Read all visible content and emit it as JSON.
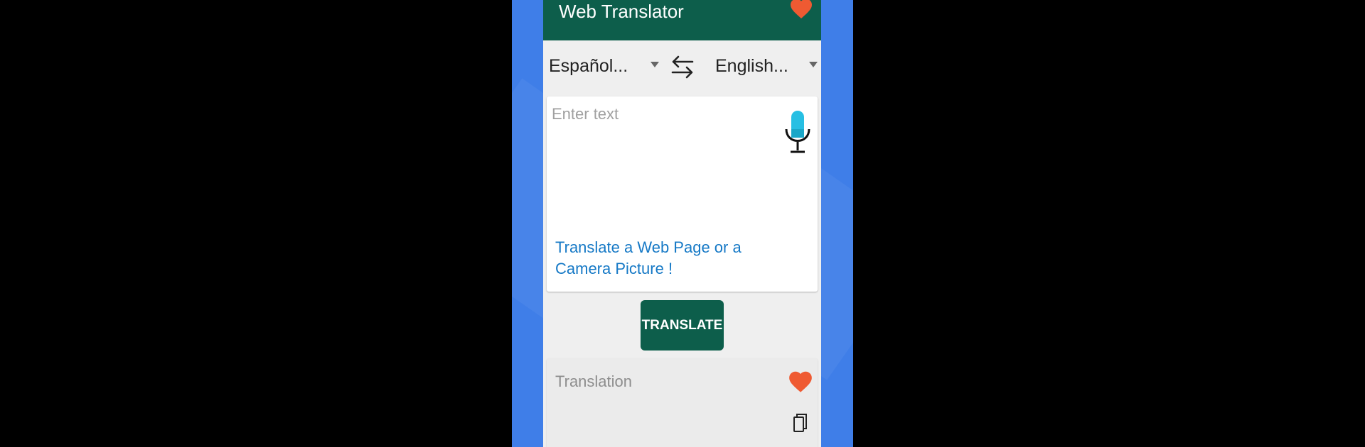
{
  "app": {
    "title": "Web Translator"
  },
  "languages": {
    "source": "Español...",
    "target": "English..."
  },
  "input": {
    "placeholder": "Enter text",
    "link": "Translate a Web Page or a Camera Picture !"
  },
  "actions": {
    "translate_label": "TRANSLATE"
  },
  "output": {
    "label": "Translation"
  },
  "icons": [
    "heart-icon",
    "swap-icon",
    "microphone-icon",
    "copy-icon",
    "dropdown-arrow-icon"
  ],
  "colors": {
    "primary": "#0d5e4b",
    "accent_heart": "#ef5a32",
    "link": "#1679c6",
    "backdrop": "#3f7ee8",
    "mic": "#27bfe3"
  }
}
